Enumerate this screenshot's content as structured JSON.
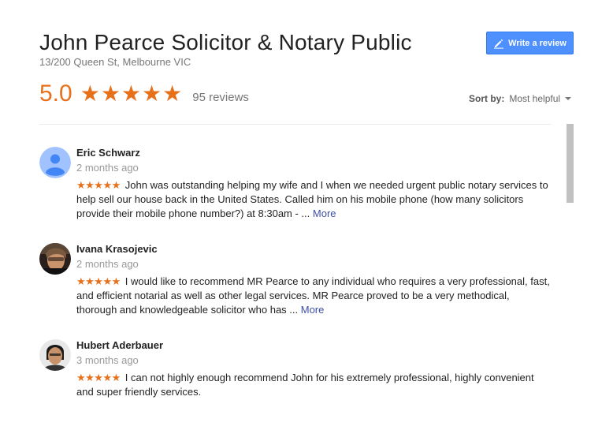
{
  "business": {
    "name": "John Pearce Solicitor & Notary Public",
    "address": "13/200 Queen St, Melbourne VIC"
  },
  "write_review_label": "Write a review",
  "summary": {
    "rating": "5.0",
    "stars": "★★★★★",
    "count": "95 reviews"
  },
  "sort": {
    "label": "Sort by:",
    "value": "Most helpful"
  },
  "colors": {
    "accent": "#e7711b",
    "button": "#4d90fe",
    "link": "#3d4fa8"
  },
  "reviews": [
    {
      "name": "Eric Schwarz",
      "time": "2 months ago",
      "stars": "★★★★★",
      "text": "John was outstanding helping my wife and I when we needed urgent public notary services to help sell our house back in the United States.  Called him on his mobile phone (how many solicitors provide their mobile phone number?) at 8:30am - ...",
      "more": "More",
      "avatar_icon": "default-person-icon"
    },
    {
      "name": "Ivana Krasojevic",
      "time": "2 months ago",
      "stars": "★★★★★",
      "text": "I would like to recommend MR Pearce to any individual who requires a very professional, fast, and efficient notarial as well as other legal services.  MR Pearce proved to be a very methodical, thorough and knowledgeable solicitor who has ...",
      "more": "More",
      "avatar_icon": "profile-photo"
    },
    {
      "name": "Hubert Aderbauer",
      "time": "3 months ago",
      "stars": "★★★★★",
      "text": "I can not highly enough recommend John for his extremely professional, highly convenient and super friendly services.",
      "avatar_icon": "profile-photo"
    }
  ]
}
